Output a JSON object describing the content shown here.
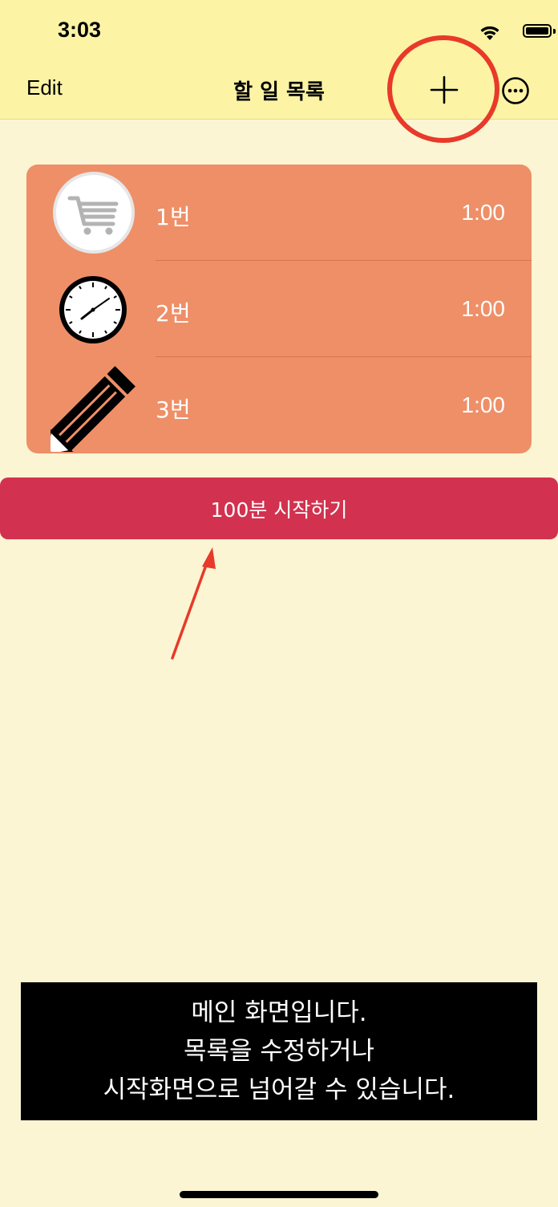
{
  "status_bar": {
    "time": "3:03"
  },
  "nav": {
    "edit_label": "Edit",
    "title": "할 일 목록",
    "add_icon": "plus-icon",
    "more_icon": "ellipsis-circle-icon"
  },
  "list": {
    "items": [
      {
        "label": "1번",
        "value": "1:00",
        "icon": "shopping-cart-icon"
      },
      {
        "label": "2번",
        "value": "1:00",
        "icon": "clock-icon"
      },
      {
        "label": "3번",
        "value": "1:00",
        "icon": "pencil-icon"
      }
    ]
  },
  "start_button": {
    "label": "100분 시작하기"
  },
  "caption": {
    "lines": [
      "메인 화면입니다.",
      "목록을 수정하거나",
      "시작화면으로 넘어갈 수 있습니다."
    ]
  },
  "colors": {
    "nav_bg": "#FCF3A4",
    "page_bg": "#FBF5D3",
    "card_bg": "#EE8F68",
    "start_button_bg": "#D2324F",
    "annotation_red": "#E8392A"
  }
}
